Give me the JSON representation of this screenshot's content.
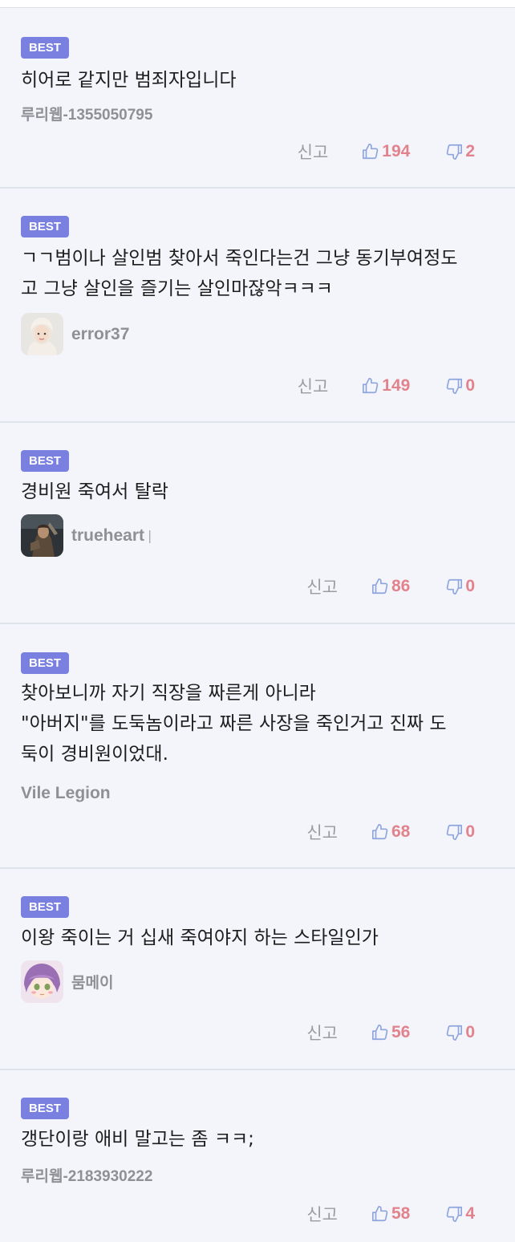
{
  "badge_label": "BEST",
  "report_label": "신고",
  "comments": [
    {
      "text": [
        "히어로 같지만 범죄자입니다"
      ],
      "author": "루리웹-1355050795",
      "likes": "194",
      "dislikes": "2"
    },
    {
      "text": [
        "ㄱㄱ범이나 살인범 찾아서 죽인다는건 그냥 동기부여정도",
        "고 그냥 살인을 즐기는 살인마잖악ㅋㅋㅋ"
      ],
      "author": "error37",
      "likes": "149",
      "dislikes": "0"
    },
    {
      "text": [
        "경비원 죽여서 탈락"
      ],
      "author": "trueheart",
      "likes": "86",
      "dislikes": "0"
    },
    {
      "text": [
        "찾아보니까 자기 직장을 짜른게 아니라",
        "\"아버지\"를 도둑놈이라고 짜른 사장을 죽인거고 진짜 도",
        "둑이 경비원이었대."
      ],
      "author": "Vile Legion",
      "likes": "68",
      "dislikes": "0"
    },
    {
      "text": [
        "이왕 죽이는 거 십새 죽여야지 하는 스타일인가"
      ],
      "author": "뭄메이",
      "likes": "56",
      "dislikes": "0"
    },
    {
      "text": [
        "갱단이랑 애비 말고는 좀 ㅋㅋ;"
      ],
      "author": "루리웹-2183930222",
      "likes": "58",
      "dislikes": "4"
    }
  ]
}
